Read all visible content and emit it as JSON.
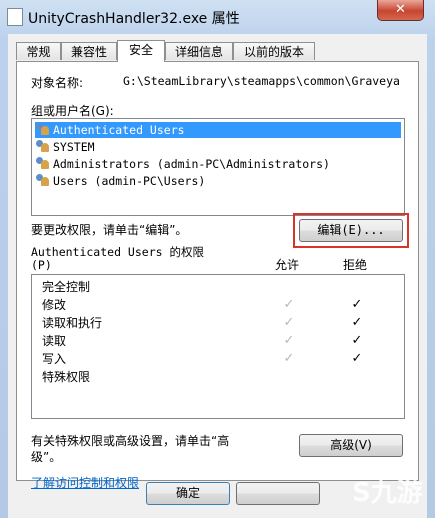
{
  "window": {
    "title": "UnityCrashHandler32.exe 属性",
    "close_glyph": "✕"
  },
  "tabs": [
    {
      "label": "常规",
      "active": false
    },
    {
      "label": "兼容性",
      "active": false
    },
    {
      "label": "安全",
      "active": true
    },
    {
      "label": "详细信息",
      "active": false
    },
    {
      "label": "以前的版本",
      "active": false
    }
  ],
  "security": {
    "object_name_label": "对象名称:",
    "object_name_value": "G:\\SteamLibrary\\steamapps\\common\\Graveya",
    "groups_label": "组或用户名(G):",
    "users": [
      {
        "name": "Authenticated Users",
        "selected": true,
        "icon": "users-group-icon"
      },
      {
        "name": "SYSTEM",
        "selected": false,
        "icon": "users-group-icon"
      },
      {
        "name": "Administrators (admin-PC\\Administrators)",
        "selected": false,
        "icon": "users-group-icon"
      },
      {
        "name": "Users (admin-PC\\Users)",
        "selected": false,
        "icon": "users-group-icon"
      }
    ],
    "change_hint": "要更改权限，请单击“编辑”。",
    "edit_button": "编辑(E)...",
    "perm_title_line1": "Authenticated Users 的权限",
    "perm_title_line2": "(P)",
    "allow_header": "允许",
    "deny_header": "拒绝",
    "permissions": [
      {
        "name": "完全控制",
        "allow": false,
        "deny": false
      },
      {
        "name": "修改",
        "allow": true,
        "deny": true
      },
      {
        "name": "读取和执行",
        "allow": true,
        "deny": true
      },
      {
        "name": "读取",
        "allow": true,
        "deny": true
      },
      {
        "name": "写入",
        "allow": true,
        "deny": true
      },
      {
        "name": "特殊权限",
        "allow": false,
        "deny": false
      }
    ],
    "check_glyph": "✓",
    "advanced_hint_line1": "有关特殊权限或高级设置，请单击“高",
    "advanced_hint_line2": "级”。",
    "advanced_button": "高级(V)",
    "learn_link": "了解访问控制和权限"
  },
  "footer": {
    "ok_button": "确定"
  },
  "watermark": {
    "brand": "九游",
    "brand_mark": "S"
  },
  "colors": {
    "selection": "#3399ff",
    "highlight_box": "#d9332b",
    "link": "#0066cc"
  }
}
